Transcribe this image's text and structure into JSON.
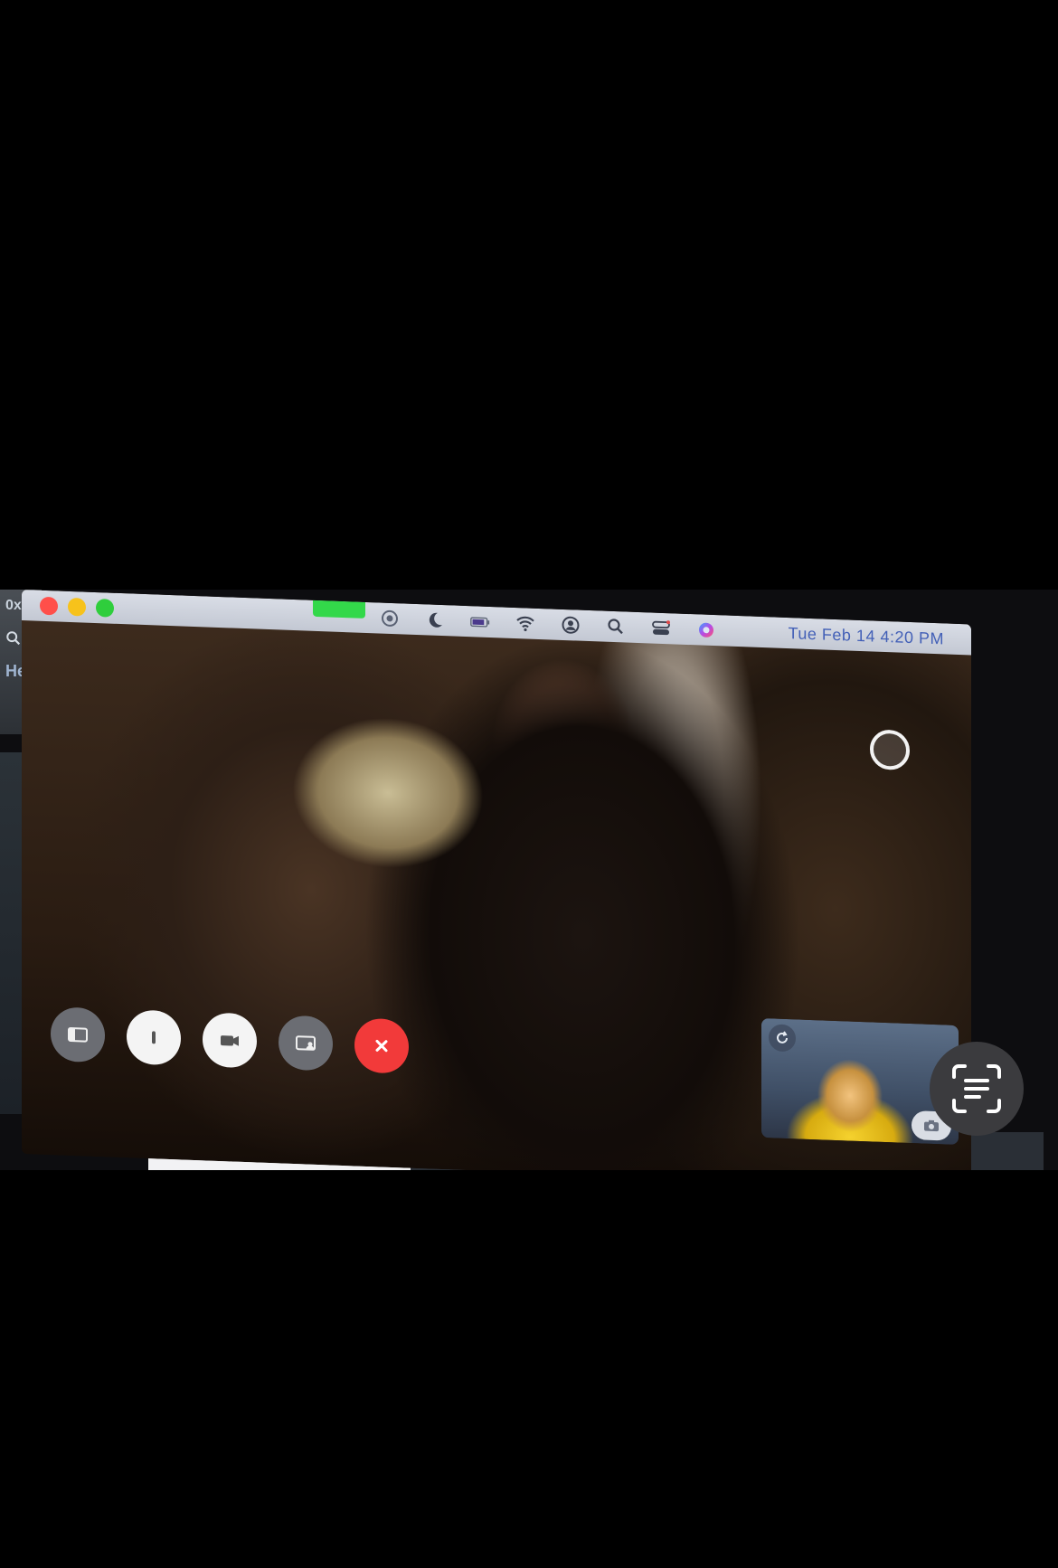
{
  "side_window": {
    "zoom_label": "0x",
    "link_text": "He"
  },
  "menubar": {
    "date_time": "Tue Feb 14  4:20 PM",
    "status_icons": [
      "screen-record-icon",
      "moon-icon",
      "battery-icon",
      "wifi-icon",
      "user-icon",
      "search-icon",
      "control-center-icon",
      "siri-icon"
    ]
  },
  "call_controls": [
    "sidebar-icon",
    "mute-icon",
    "video-camera-icon",
    "share-screen-icon",
    "end-call-icon"
  ],
  "colors": {
    "end_call": "#f23a3a",
    "traffic_red": "#ff4f4a",
    "traffic_yellow": "#f7c21b",
    "traffic_green": "#2fce3c",
    "clock_text": "#4360b7"
  }
}
